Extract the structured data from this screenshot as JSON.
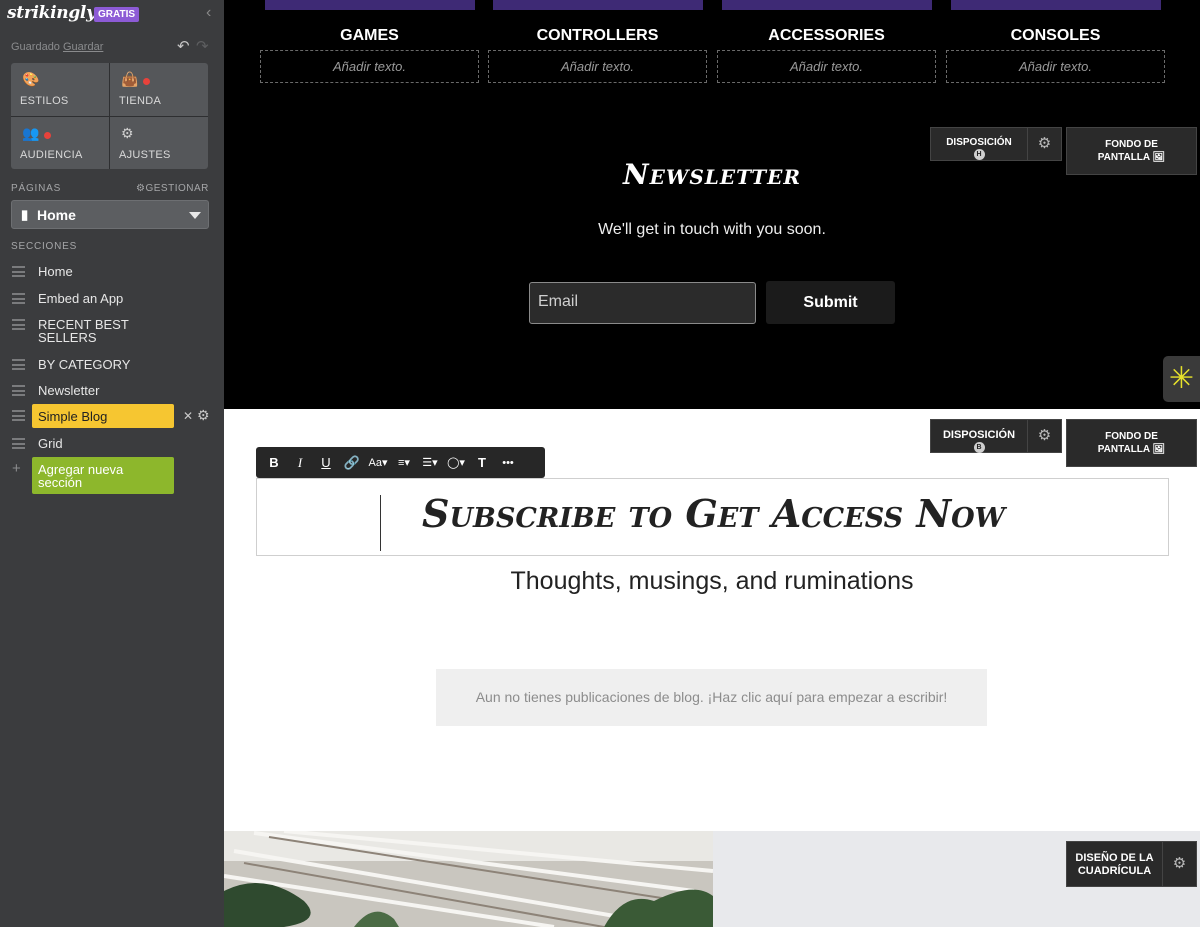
{
  "sidebar": {
    "brand": "strikingly",
    "plan_badge": "GRATIS",
    "saved_prefix": "Guardado",
    "save_link": "Guardar",
    "tiles": [
      {
        "label": "ESTILOS",
        "icon": "palette-icon",
        "dot": false
      },
      {
        "label": "TIENDA",
        "icon": "bag-icon",
        "dot": true
      },
      {
        "label": "AUDIENCIA",
        "icon": "people-icon",
        "dot": true
      },
      {
        "label": "AJUSTES",
        "icon": "gear-icon",
        "dot": false
      }
    ],
    "pages_label": "PÁGINAS",
    "manage_label": "GESTIONAR",
    "current_page": "Home",
    "sections_label": "SECCIONES",
    "sections": [
      "Home",
      "Embed an App",
      "RECENT BEST SELLERS",
      "BY CATEGORY",
      "Newsletter",
      "Simple Blog",
      "Grid"
    ],
    "active_section": "Simple Blog",
    "add_section": "Agregar nueva sección",
    "notification_color": "#e8423b"
  },
  "categories": [
    {
      "title": "GAMES",
      "placeholder": "Añadir texto."
    },
    {
      "title": "CONTROLLERS",
      "placeholder": "Añadir texto."
    },
    {
      "title": "ACCESSORIES",
      "placeholder": "Añadir texto."
    },
    {
      "title": "CONSOLES",
      "placeholder": "Añadir texto."
    }
  ],
  "section_tools": {
    "layout": "DISPOSICIÓN",
    "layout_letter_newsletter": "H",
    "layout_letter_blog": "B",
    "background_line1": "FONDO DE",
    "background_line2": "PANTALLA",
    "grid_design_line1": "DISEÑO DE LA",
    "grid_design_line2": "CUADRÍCULA"
  },
  "newsletter": {
    "title": "Newsletter",
    "subtitle": "We'll get in touch with you soon.",
    "email_placeholder": "Email",
    "submit": "Submit"
  },
  "editor_toolbar": [
    "B",
    "I",
    "U",
    "🔗",
    "Aa▾",
    "≡▾",
    "☰▾",
    "◯▾",
    "T",
    "•••"
  ],
  "blog": {
    "title": "Subscribe to Get Access Now",
    "subtitle": "Thoughts, musings, and ruminations",
    "empty_message": "Aun no tienes publicaciones de blog. ¡Haz clic aquí para empezar a escribir!"
  },
  "colors": {
    "sidebar_bg": "#3b3c3e",
    "active_section": "#f6c631",
    "add_section": "#8db72c",
    "badge": "#8d5bd6",
    "accent_spark": "#e6e12b"
  }
}
